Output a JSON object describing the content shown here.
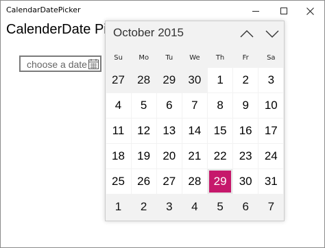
{
  "window": {
    "title": "CalendarDatePicker"
  },
  "page": {
    "heading": "CalenderDate Pick"
  },
  "date_picker": {
    "placeholder": "choose a date"
  },
  "calendar": {
    "month_year": "October 2015",
    "days_of_week": [
      "Su",
      "Mo",
      "Tu",
      "We",
      "Th",
      "Fr",
      "Sa"
    ],
    "weeks": [
      [
        {
          "d": "27",
          "other": true
        },
        {
          "d": "28",
          "other": true
        },
        {
          "d": "29",
          "other": true
        },
        {
          "d": "30",
          "other": true
        },
        {
          "d": "1"
        },
        {
          "d": "2"
        },
        {
          "d": "3"
        }
      ],
      [
        {
          "d": "4"
        },
        {
          "d": "5"
        },
        {
          "d": "6"
        },
        {
          "d": "7"
        },
        {
          "d": "8"
        },
        {
          "d": "9"
        },
        {
          "d": "10"
        }
      ],
      [
        {
          "d": "11"
        },
        {
          "d": "12"
        },
        {
          "d": "13"
        },
        {
          "d": "14"
        },
        {
          "d": "15"
        },
        {
          "d": "16"
        },
        {
          "d": "17"
        }
      ],
      [
        {
          "d": "18"
        },
        {
          "d": "19"
        },
        {
          "d": "20"
        },
        {
          "d": "21"
        },
        {
          "d": "22"
        },
        {
          "d": "23"
        },
        {
          "d": "24"
        }
      ],
      [
        {
          "d": "25"
        },
        {
          "d": "26"
        },
        {
          "d": "27"
        },
        {
          "d": "28"
        },
        {
          "d": "29",
          "today": true
        },
        {
          "d": "30"
        },
        {
          "d": "31"
        }
      ],
      [
        {
          "d": "1",
          "other": true
        },
        {
          "d": "2",
          "other": true
        },
        {
          "d": "3",
          "other": true
        },
        {
          "d": "4",
          "other": true
        },
        {
          "d": "5",
          "other": true
        },
        {
          "d": "6",
          "other": true
        },
        {
          "d": "7",
          "other": true
        }
      ]
    ],
    "today_color": "#c6186b",
    "icons": {
      "previous": "chevron-up-icon",
      "next": "chevron-down-icon",
      "picker": "calendar-icon"
    }
  },
  "caption_icons": [
    "minimize-icon",
    "maximize-icon",
    "close-icon"
  ]
}
